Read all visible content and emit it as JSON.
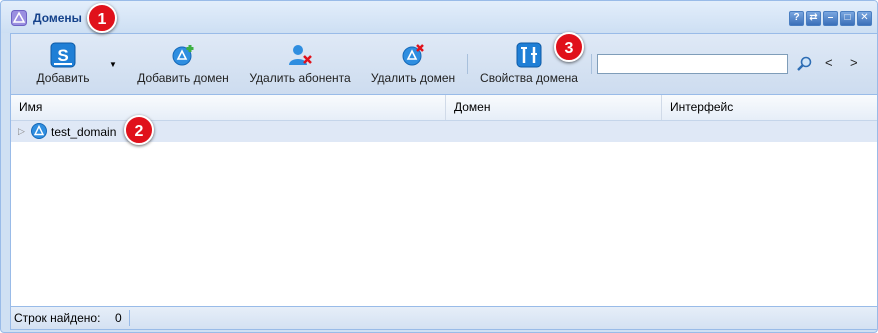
{
  "window": {
    "title": "Домены"
  },
  "badges": {
    "b1": "1",
    "b2": "2",
    "b3": "3"
  },
  "toolbar": {
    "add_label": "Добавить",
    "add_domain_label": "Добавить домен",
    "delete_subscriber_label": "Удалить абонента",
    "delete_domain_label": "Удалить домен",
    "domain_properties_label": "Свойства домена",
    "search_value": "",
    "prev_label": "<",
    "next_label": ">"
  },
  "title_tools": {
    "help": "?",
    "refresh": "⇄",
    "minimize": "–",
    "maximize": "□",
    "close": "✕"
  },
  "grid": {
    "columns": [
      "Имя",
      "Домен",
      "Интерфейс"
    ],
    "rows": [
      {
        "name": "test_domain",
        "domain": "",
        "interface": ""
      }
    ]
  },
  "status": {
    "label": "Строк найдено:",
    "count": "0"
  },
  "colors": {
    "accent": "#15428b",
    "badge": "#e0111b",
    "border": "#99bbe8"
  }
}
